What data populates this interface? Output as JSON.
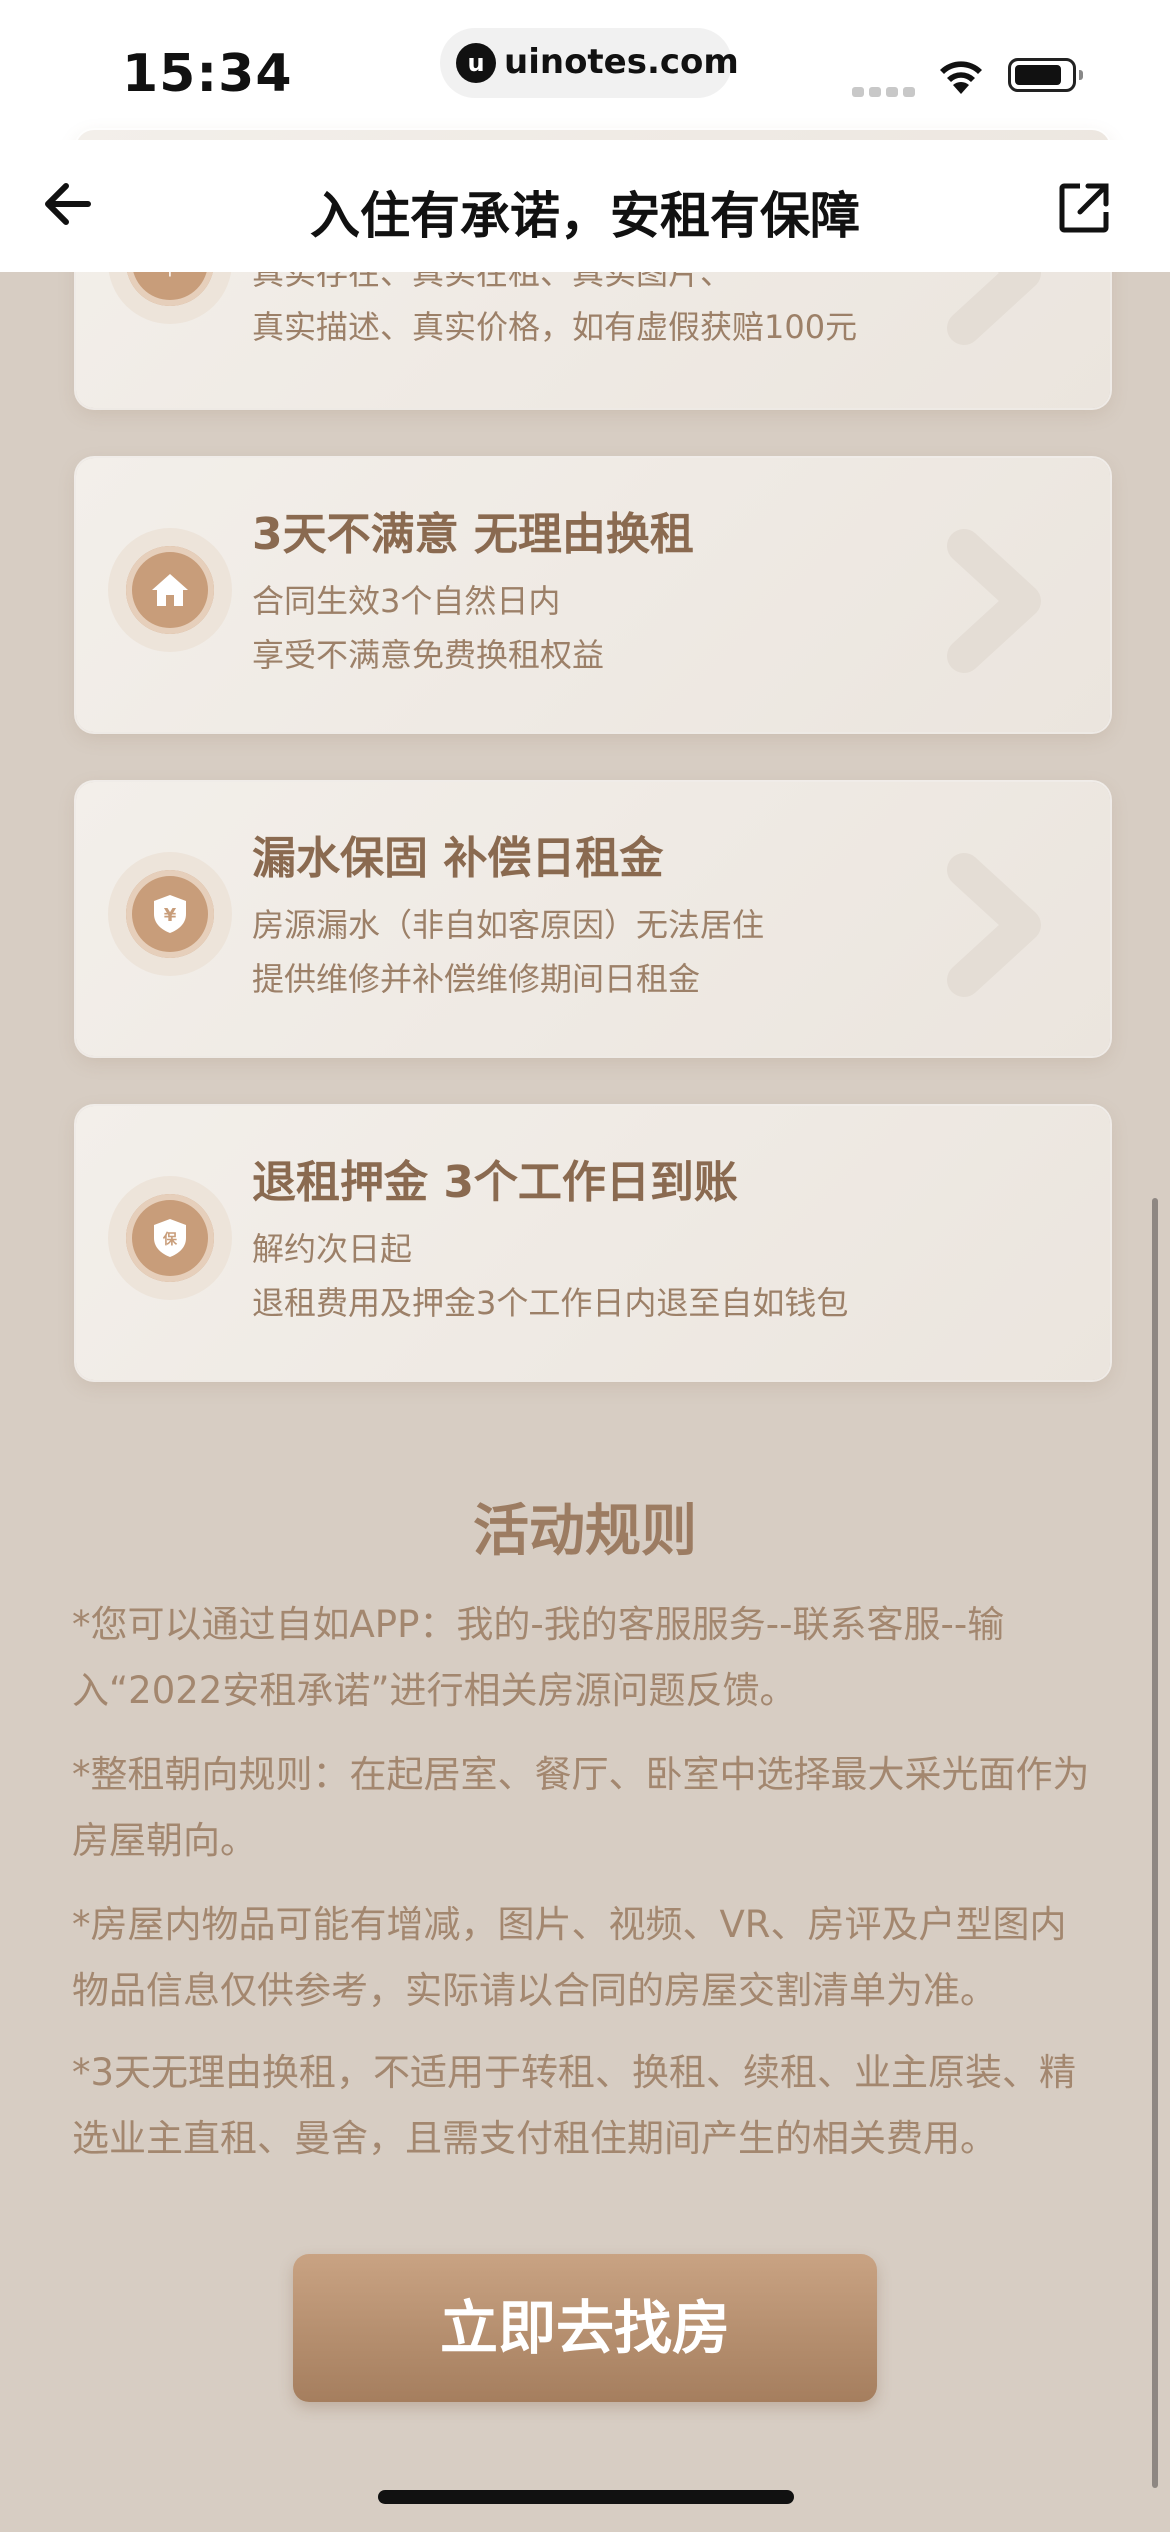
{
  "status_bar": {
    "time": "15:34",
    "url": "uinotes.com",
    "url_icon": "u"
  },
  "nav": {
    "title": "入住有承诺，安租有保障",
    "back_icon": "arrow-left-icon",
    "share_icon": "external-link-icon"
  },
  "cards": [
    {
      "title": "",
      "line1": "真实存在、真实在租、真实图片、",
      "line2": "真实描述、真实价格，如有虚假获赔100元",
      "icon": "money-icon"
    },
    {
      "title": "3天不满意 无理由换租",
      "line1": "合同生效3个自然日内",
      "line2": "享受不满意免费换租权益",
      "icon": "home-icon"
    },
    {
      "title": "漏水保固 补偿日租金",
      "line1": "房源漏水（非自如客原因）无法居住",
      "line2": "提供维修并补偿维修期间日租金",
      "icon": "yen-shield-icon"
    },
    {
      "title": "退租押金 3个工作日到账",
      "line1": "解约次日起",
      "line2": "退租费用及押金3个工作日内退至自如钱包",
      "icon": "shield-bao-icon",
      "icon_text": "保"
    }
  ],
  "rules": {
    "title": "活动规则",
    "items": [
      "*您可以通过自如APP：我的-我的客服服务--联系客服--输入“2022安租承诺”进行相关房源问题反馈。",
      "*整租朝向规则：在起居室、餐厅、卧室中选择最大采光面作为房屋朝向。",
      "*房屋内物品可能有增减，图片、视频、VR、房评及户型图内物品信息仅供参考，实际请以合同的房屋交割清单为准。",
      "*3天无理由换租，不适用于转租、换租、续租、业主原装、精选业主直租、曼舍，且需支付租住期间产生的相关费用。"
    ]
  },
  "cta": {
    "label": "立即去找房"
  },
  "colors": {
    "background": "#d7cdc3",
    "accent": "#a57e5e",
    "card": "#f0ebe5"
  }
}
